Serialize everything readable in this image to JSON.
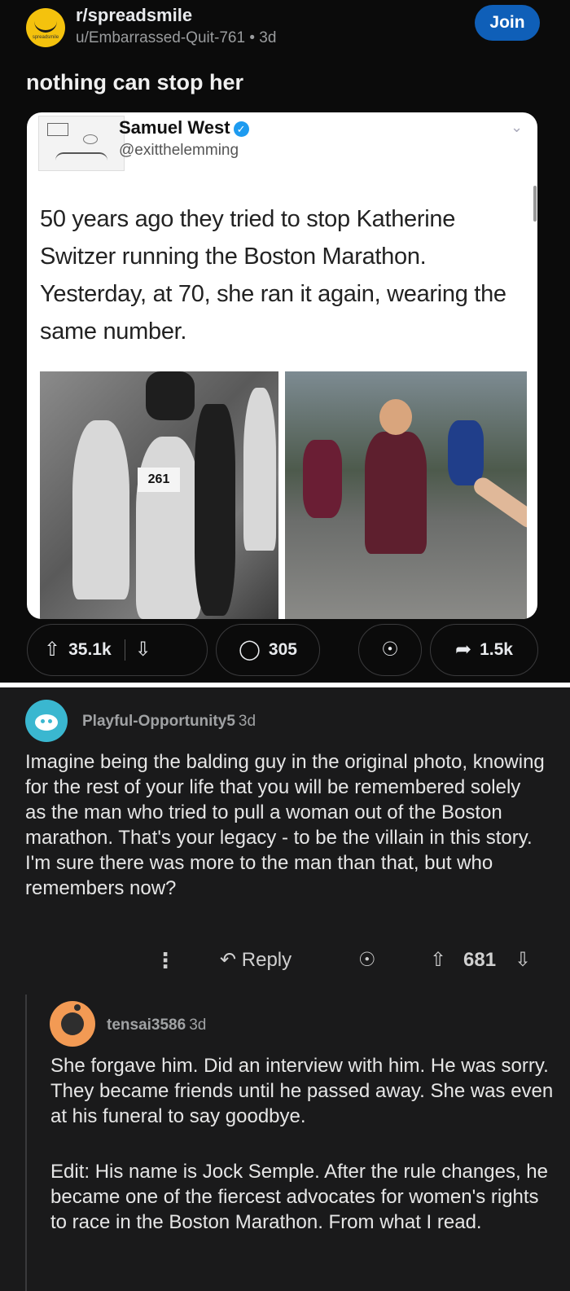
{
  "post": {
    "subreddit": "r/spreadsmile",
    "subreddit_avatar_text": "spreadsmile",
    "author": "u/Embarrassed-Quit-761",
    "age": "3d",
    "join_label": "Join",
    "title": "nothing can stop her"
  },
  "tweet": {
    "name": "Samuel West",
    "handle": "@exitthelemming",
    "text": "50 years ago they tried to stop Katherine Switzer running the Boston Marathon. Yesterday, at 70, she ran it again, wearing the same number.",
    "bib_number": "261"
  },
  "actions": {
    "upvotes": "35.1k",
    "comments": "305",
    "shares": "1.5k"
  },
  "comments": [
    {
      "user": "Playful-Opportunity5",
      "age": "3d",
      "body": "Imagine being the balding guy in the original photo, knowing for the rest of your life that you will be remembered solely as the man who tried to pull a woman out of the Boston marathon. That's your legacy - to be the villain in this story. I'm sure there was more to the man than that, but who remembers now?",
      "reply_label": "Reply",
      "score": "681"
    },
    {
      "user": "tensai3586",
      "age": "3d",
      "body": "She forgave him. Did an interview with him. He was sorry. They became friends until he passed away. She was even at his funeral to say goodbye.",
      "edit": "Edit: His name is Jock Semple. After the rule changes, he became one of the fiercest advocates for women's rights to race in the Boston Marathon. From what I read."
    }
  ],
  "icons": {
    "upvote": "upvote-arrow-icon",
    "downvote": "downvote-arrow-icon",
    "comment": "comment-bubble-icon",
    "award": "award-icon",
    "share": "share-arrow-icon",
    "more": "more-vertical-icon",
    "reply": "reply-arrow-icon",
    "verified": "verified-badge-icon"
  },
  "colors": {
    "join_button": "#0f5fb8",
    "verified": "#1d9bf0",
    "subreddit_avatar": "#f4c20d",
    "commenter1_avatar": "#3ab7d0",
    "commenter2_avatar": "#f29a54"
  }
}
